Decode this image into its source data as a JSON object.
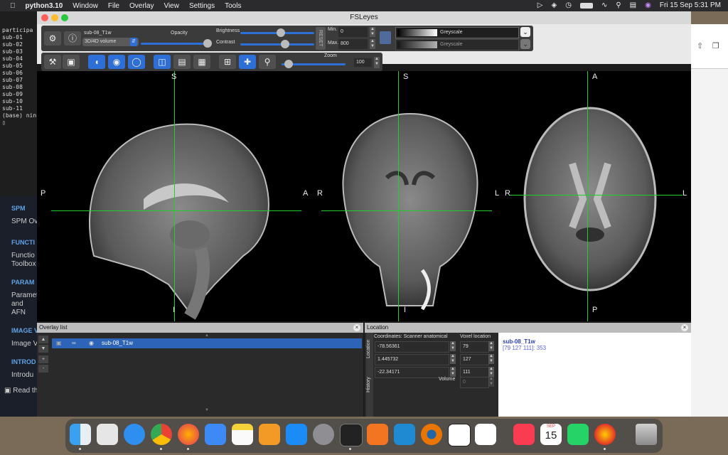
{
  "menubar": {
    "app": "python3.10",
    "items": [
      "Window",
      "File",
      "Overlay",
      "View",
      "Settings",
      "Tools"
    ],
    "datetime": "Fri 15 Sep  5:31 PM"
  },
  "terminal": {
    "lines": [
      "participa",
      "sub-01",
      "sub-02",
      "sub-03",
      "sub-04",
      "sub-05",
      "sub-06",
      "sub-07",
      "sub-08",
      "sub-09",
      "sub-10",
      "sub-11",
      "(base) nin"
    ]
  },
  "docsidebar": {
    "items": [
      {
        "heading": "SPM",
        "text": "SPM Ov"
      },
      {
        "heading": "FUNCTI",
        "text": "Functio Toolbox"
      },
      {
        "heading": "PARAM",
        "text": "Paramet and AFN"
      },
      {
        "heading": "IMAGE V",
        "text": "Image V"
      },
      {
        "heading": "INTROD",
        "text": "Introdu"
      }
    ],
    "footer": "Read th"
  },
  "window": {
    "title": "FSLeyes"
  },
  "toolbar": {
    "overlay_name": "sub-08_T1w",
    "overlay_type": "3D/4D volume",
    "opacity_label": "Opacity",
    "brightness_label": "Brightness",
    "contrast_label": "Contrast",
    "min_label": "Min.",
    "max_label": "Max.",
    "min_value": "0",
    "max_value": "800",
    "reset_label": "RESET",
    "colormap": "Greyscale",
    "colormap2": "Greyscale",
    "zoom_label": "Zoom",
    "zoom_value": "100",
    "opacity_level": 1.0,
    "brightness_level": 0.55,
    "contrast_level": 0.62,
    "zoom_level": 0.05
  },
  "views": {
    "sagittal": {
      "top": "S",
      "left": "P",
      "right": "A",
      "bottom": "I"
    },
    "coronal": {
      "top": "S",
      "left": "R",
      "right": "L",
      "bottom": "I"
    },
    "axial": {
      "top": "A",
      "left": "R",
      "right": "L",
      "bottom": "P"
    }
  },
  "overlay_list": {
    "title": "Overlay list",
    "items": [
      {
        "name": "sub-08_T1w"
      }
    ]
  },
  "location": {
    "title": "Location",
    "tab_location": "Location",
    "tab_history": "History",
    "coords_header": "Coordinates: Scanner anatomical",
    "voxel_header": "Voxel location",
    "coords": [
      "-78.56361",
      "1.445732",
      "-22.34171"
    ],
    "voxels": [
      "79",
      "127",
      "111"
    ],
    "volume_label": "Volume",
    "volume_value": "0",
    "info_name": "sub-08_T1w",
    "info_value": "[79 127 111]: 353"
  },
  "dock": {
    "calendar_month": "SEP",
    "calendar_day": "15"
  }
}
